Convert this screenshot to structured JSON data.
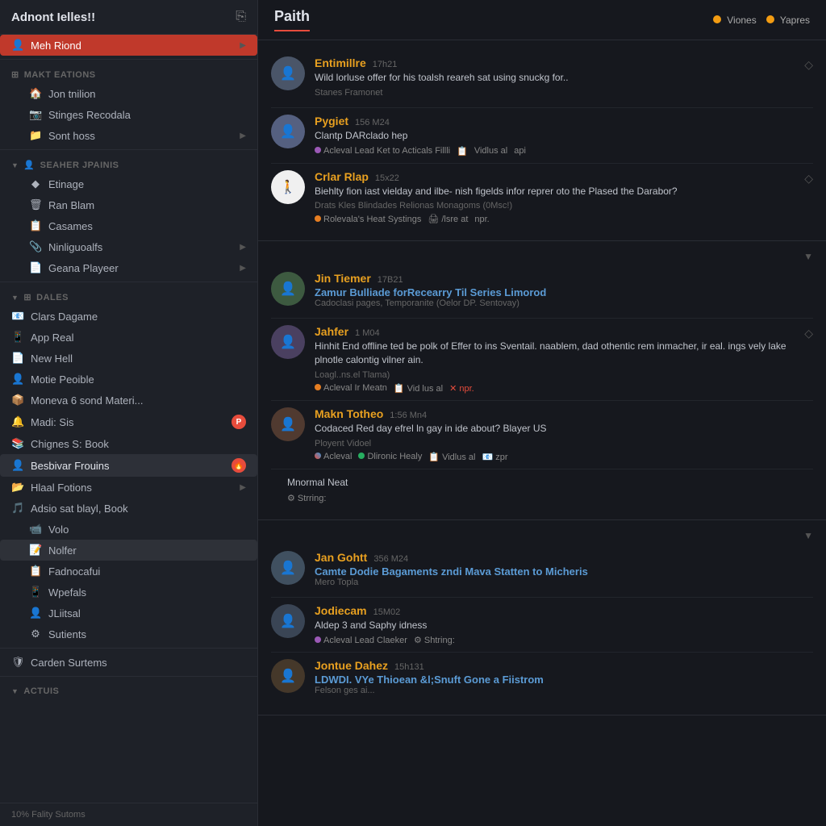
{
  "sidebar": {
    "title": "Adnont Ielles!!",
    "top_item": "Meh Riond",
    "sections": [
      {
        "label": "Makt eations",
        "items": [
          {
            "icon": "🏠",
            "label": "Jon tnilion"
          },
          {
            "icon": "📷",
            "label": "Stinges Recodala"
          },
          {
            "icon": "📁",
            "label": "Sont hoss",
            "chevron": true
          }
        ]
      },
      {
        "label": "Seaher Jpainis",
        "expandable": true,
        "items": [
          {
            "icon": "◆",
            "label": "Etinage",
            "indent": 1
          },
          {
            "icon": "🗑",
            "label": "Ran Blam",
            "indent": 1
          },
          {
            "icon": "📋",
            "label": "Casames",
            "indent": 1
          },
          {
            "icon": "📎",
            "label": "Ninliguoalfs",
            "indent": 1,
            "chevron": true
          },
          {
            "icon": "📄",
            "label": "Geana Playeer",
            "indent": 1,
            "chevron": true
          }
        ]
      },
      {
        "label": "Dales",
        "expandable": true,
        "items": [
          {
            "icon": "📧",
            "label": "Clars Dagame"
          },
          {
            "icon": "📱",
            "label": "App Real"
          },
          {
            "icon": "📄",
            "label": "New Hell"
          },
          {
            "icon": "👤",
            "label": "Motie Peoible"
          },
          {
            "icon": "📦",
            "label": "Moneva 6 sond Materi..."
          },
          {
            "icon": "🔔",
            "label": "Madi: Sis",
            "badge": "P"
          },
          {
            "icon": "📚",
            "label": "Chignes S: Book"
          },
          {
            "icon": "👤",
            "label": "Besbivar Frouins",
            "badge_red": true,
            "selected": true
          },
          {
            "icon": "📂",
            "label": "Hlaal Fotions",
            "chevron": true
          },
          {
            "icon": "🎵",
            "label": "Adsio sat blayl, Book"
          },
          {
            "icon": "📹",
            "label": "Volo",
            "indent": 1
          },
          {
            "icon": "📝",
            "label": "Nolfer",
            "indent": 1,
            "highlight": true
          },
          {
            "icon": "📋",
            "label": "Fadnocafui",
            "indent": 1
          },
          {
            "icon": "📱",
            "label": "Wpefals",
            "indent": 1
          },
          {
            "icon": "👤",
            "label": "JLiitsal",
            "indent": 1
          },
          {
            "icon": "⚙",
            "label": "Sutients",
            "indent": 1
          }
        ]
      },
      {
        "label": "Carden Surtems",
        "items": []
      },
      {
        "label": "Actuis",
        "expandable": true,
        "items": []
      }
    ],
    "footer": "10% Fality Sutoms"
  },
  "main": {
    "title": "Paith",
    "status_items": [
      {
        "label": "Viones",
        "color": "#f39c12"
      },
      {
        "label": "Yapres",
        "color": "#f39c12"
      }
    ],
    "feed_groups": [
      {
        "items": [
          {
            "name": "Entimillre",
            "time": "17h21",
            "text": "Wild lorluse offer for his toalsh reareh sat using snuckg for..",
            "subtext": "Stanes Framonet",
            "tags": [],
            "has_action": true
          },
          {
            "name": "Pygiet",
            "time": "156 M24",
            "text": "Clantp DARclado hep",
            "subtext": "",
            "tags": [
              {
                "color": "purple",
                "text": "Acleval Lead Ket to Acticals Fillli"
              },
              {
                "text": "Vidlus al"
              },
              {
                "text": "api"
              }
            ],
            "has_action": false
          },
          {
            "name": "Crlar Rlap",
            "time": "15x22",
            "text": "Biehlty fion iast vielday and ilbe- nish figelds infor reprer oto the Plased the Darabor?",
            "subtext": "Drats Kles Blindades Relionas Monagoms (0Msc!)",
            "tags": [
              {
                "color": "orange",
                "text": "Rolevala's Heat Systings"
              },
              {
                "text": "/lsre at"
              },
              {
                "text": "npr."
              }
            ],
            "has_action": true,
            "avatar_style": "silhouette"
          }
        ]
      },
      {
        "expand": true,
        "items": [
          {
            "name": "Jin Tiemer",
            "time": "17B21",
            "text_link": "Zamur Bulliade forRecearry Til Series Limorod",
            "subtext": "Cadoclasi pages, Temporanite (Oelor DP. Sentovay)",
            "tags": [],
            "has_action": false
          },
          {
            "name": "Jahfer",
            "time": "1 M04",
            "text": "Hinhit End offline ted be polk of Effer to ins Sventail. naablem, dad othentic rem inmacher, ir eal. ings vely lake plnotle calontig vilner ain.",
            "subtext": "Loagl..ns.el Tlama)",
            "tags": [
              {
                "color": "orange",
                "text": "Acleval Ir Meatn"
              },
              {
                "text": "Vid lus al"
              },
              {
                "color": "red",
                "text": "npr."
              }
            ],
            "has_action": true
          },
          {
            "name": "Makn Totheo",
            "time": "1:56 Mn4",
            "text": "Codaced Red day efrel ln gay in ide about? Blayer US",
            "subtext": "Ployent Vidoel",
            "tags": [
              {
                "color": "multicolor",
                "text": "Acleval"
              },
              {
                "color": "green",
                "text": "Dlironic Healy"
              },
              {
                "text": "Vidlus al"
              },
              {
                "text": "zpr"
              }
            ],
            "has_action": false
          },
          {
            "name": "",
            "time": "",
            "text": "Mnormal Neat",
            "subtext": "",
            "tags": [
              {
                "text": "Strring:"
              }
            ],
            "is_sub": true
          }
        ]
      },
      {
        "expand": true,
        "items": [
          {
            "name": "Jan Gohtt",
            "time": "356 M24",
            "text_link": "Camte Dodie Bagaments zndi Mava Statten to Micheris",
            "subtext": "Mero Topla",
            "tags": [],
            "has_action": false
          },
          {
            "name": "Jodiecam",
            "time": "15M02",
            "text": "Aldep 3 and Saphy idness",
            "subtext": "",
            "tags": [
              {
                "color": "purple",
                "text": "Acleval Lead Claeker"
              },
              {
                "text": "Shtring:"
              }
            ],
            "has_action": false
          },
          {
            "name": "Jontue Dahez",
            "time": "15h131",
            "text_link": "LDWDI. VYe Thioean &l;Snuft Gone a Fiistrom",
            "subtext": "Felson ges ai...",
            "tags": [],
            "has_action": false
          }
        ]
      }
    ]
  }
}
